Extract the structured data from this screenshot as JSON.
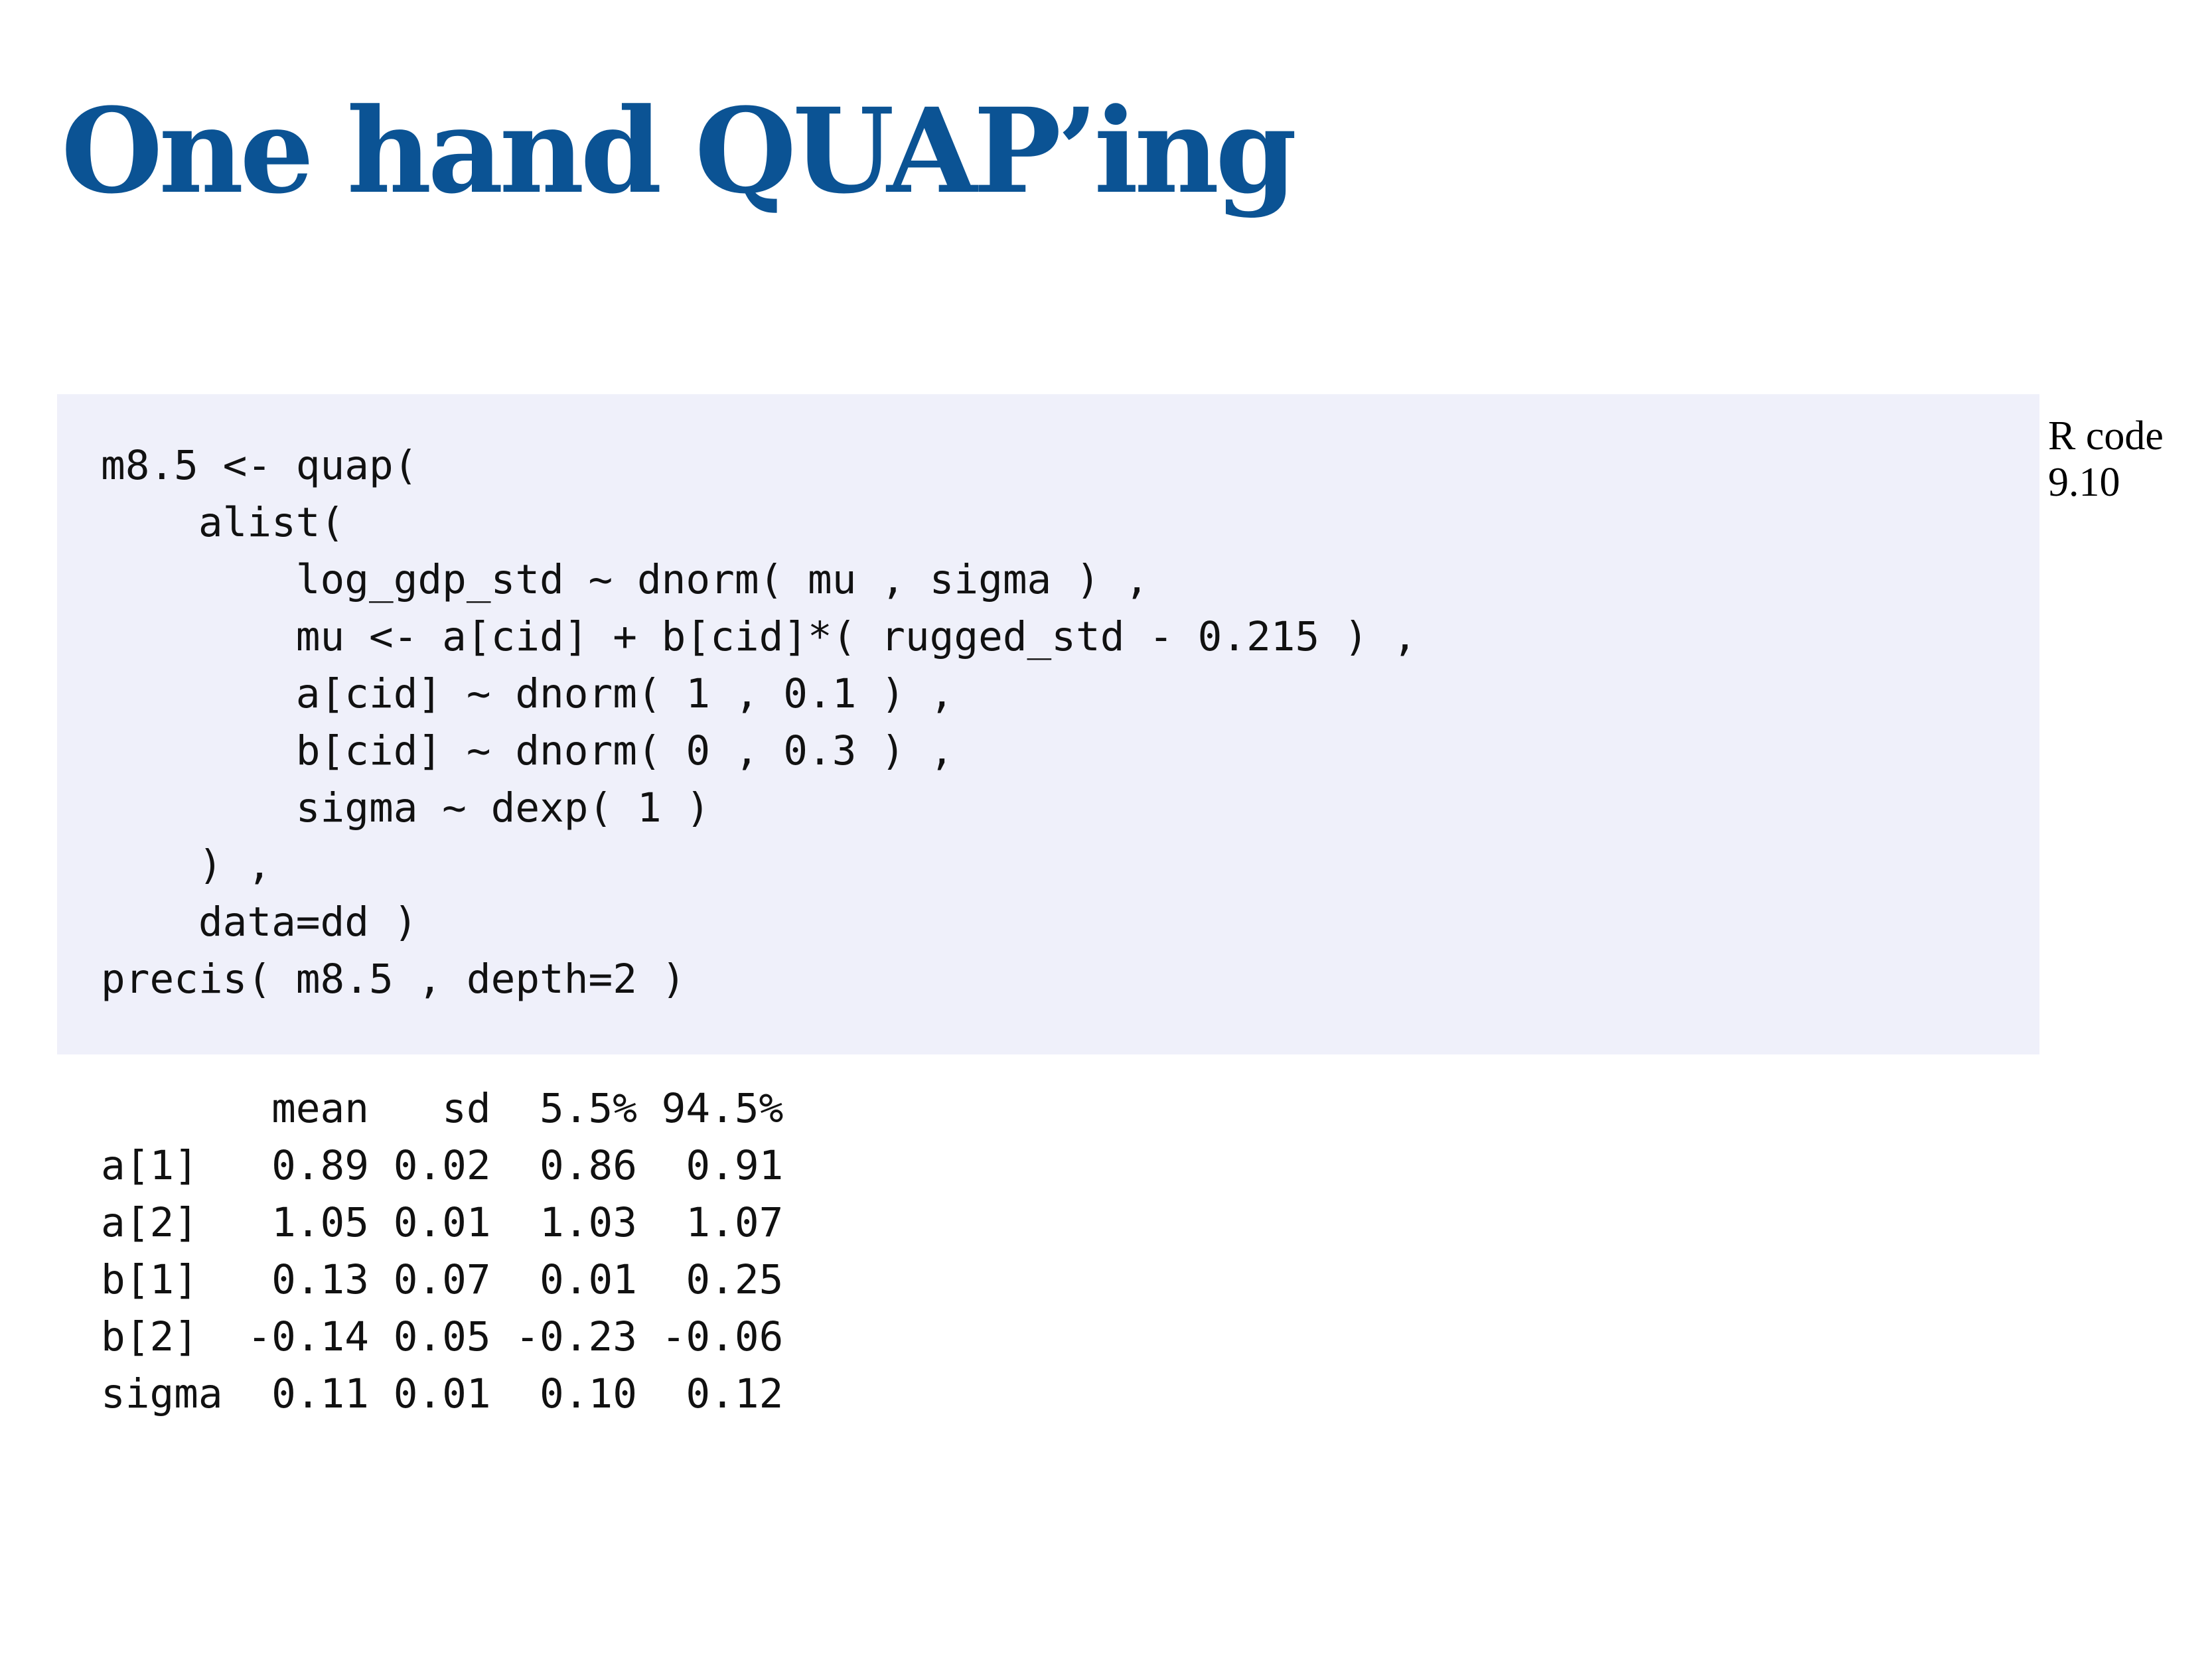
{
  "slide": {
    "title": "One hand QUAP’ing"
  },
  "code": {
    "label_line1": "R code",
    "label_line2": "9.10",
    "lines": [
      "m8.5 <- quap(",
      "    alist(",
      "        log_gdp_std ~ dnorm( mu , sigma ) ,",
      "        mu <- a[cid] + b[cid]*( rugged_std - 0.215 ) ,",
      "        a[cid] ~ dnorm( 1 , 0.1 ) ,",
      "        b[cid] ~ dnorm( 0 , 0.3 ) ,",
      "        sigma ~ dexp( 1 )",
      "    ) ,",
      "    data=dd )",
      "precis( m8.5 , depth=2 )"
    ]
  },
  "output": {
    "lines": [
      "       mean   sd  5.5% 94.5%",
      "a[1]   0.89 0.02  0.86  0.91",
      "a[2]   1.05 0.01  1.03  1.07",
      "b[1]   0.13 0.07  0.01  0.25",
      "b[2]  -0.14 0.05 -0.23 -0.06",
      "sigma  0.11 0.01  0.10  0.12"
    ]
  }
}
